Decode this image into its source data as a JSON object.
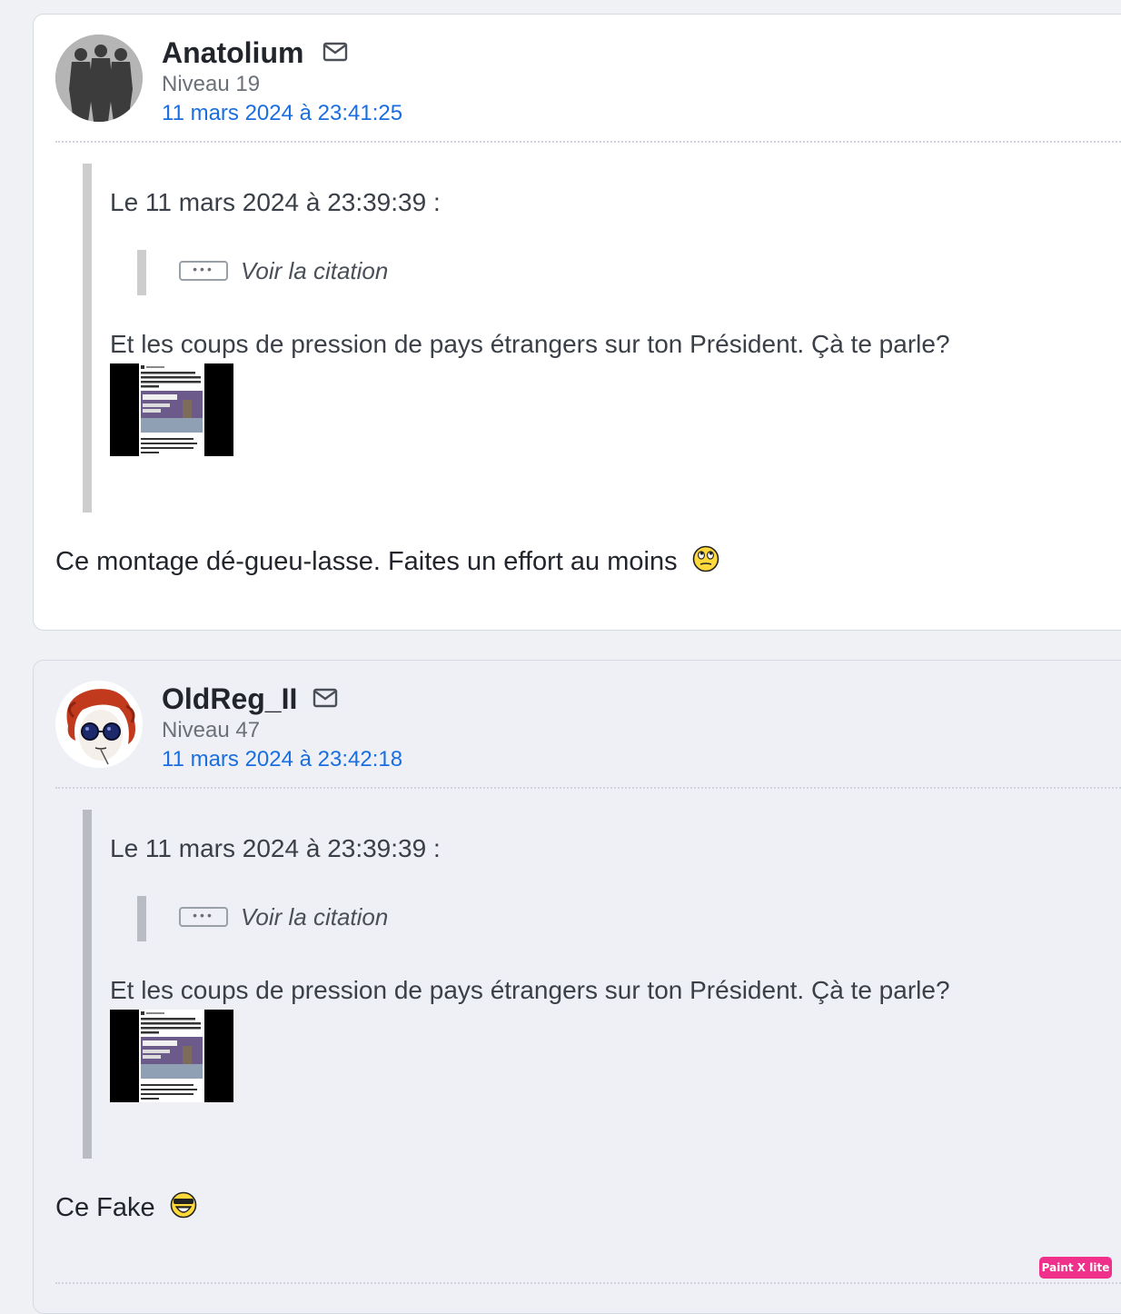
{
  "posts": [
    {
      "author": "Anatolium",
      "level": "Niveau 19",
      "date": "11 mars 2024 à 23:41:25",
      "quote": {
        "header": "Le 11 mars 2024 à 23:39:39 :",
        "nested_label": "Voir la citation",
        "text": "Et les coups de pression de pays étrangers sur ton Président. Çà te parle?"
      },
      "body": "Ce montage dé-gueu-lasse. Faites un effort au moins",
      "emoji": "rolling-eyes-smiley-icon",
      "background": "#ffffff"
    },
    {
      "author": "OldReg_II",
      "level": "Niveau 47",
      "date": "11 mars 2024 à 23:42:18",
      "quote": {
        "header": "Le 11 mars 2024 à 23:39:39 :",
        "nested_label": "Voir la citation",
        "text": "Et les coups de pression de pays étrangers sur ton Président. Çà te parle?"
      },
      "body": "Ce Fake",
      "emoji": "laughing-sunglasses-smiley-icon",
      "background": "#eef0f5"
    }
  ],
  "badge": "Paint X lite",
  "colors": {
    "link": "#1a6ee0",
    "text": "#22252b",
    "muted": "#6b7079",
    "badge": "#f0318b"
  }
}
